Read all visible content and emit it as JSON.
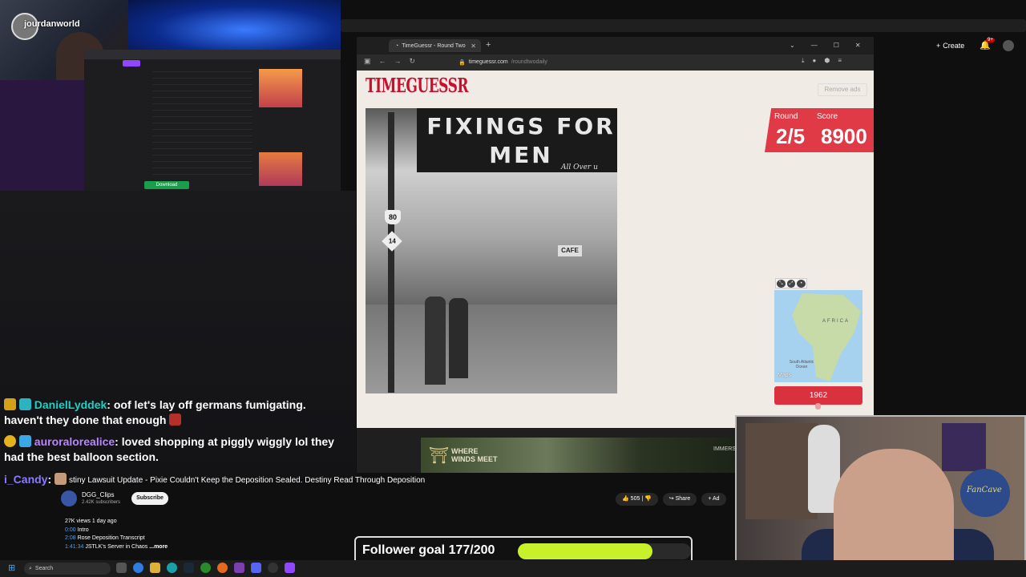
{
  "streamer": {
    "name": "jourdanworld"
  },
  "mini_screen": {
    "download_label": "Download"
  },
  "browser": {
    "tab_title": "TimeGuessr - Round Two",
    "url_domain": "timeguessr.com",
    "url_path": "/roundtwodaily"
  },
  "youtube_header": {
    "create_label": "Create",
    "notif_badge": "9+"
  },
  "game": {
    "logo": "TIMEGUESSR",
    "remove_ads": "Remove ads",
    "round_label": "Round",
    "score_label": "Score",
    "round_value": "2/5",
    "score_value": "8900",
    "photo_sign": "FIXINGS FOR MEN",
    "photo_sign_sub": "All Over u",
    "photo_route_80": "80",
    "photo_route_14": "14",
    "photo_cafe": "CAFE",
    "map_label": "AFRICA",
    "map_ocean": "South Atlantic Ocean",
    "maps_logo": "Maps",
    "year": "1962"
  },
  "ad": {
    "title_line1": "WHERE",
    "title_line2": "WINDS MEET",
    "right_text": "IMMERS"
  },
  "chat": [
    {
      "user": "DanielLyddek",
      "message": "oof let's lay off germans fumigating. haven't they done that enough"
    },
    {
      "user": "auroralorealice",
      "message": "loved shopping at piggly wiggly lol they had the best balloon section."
    },
    {
      "user": "i_Candy",
      "message": ""
    }
  ],
  "video": {
    "title": "stiny Lawsuit Update - Pixie Couldn't Keep the Deposition Sealed. Destiny Read Through Deposition",
    "channel": "DGG_Clips",
    "subscribers": "2.42K subscribers",
    "subscribe_label": "Subscribe",
    "likes": "505",
    "share_label": "Share",
    "add_label": "Ad",
    "meta": "27K views  1 day ago",
    "chapters": [
      {
        "time": "0:00",
        "label": "Intro"
      },
      {
        "time": "2:08",
        "label": "Rose Deposition Transcript"
      },
      {
        "time": "1:41:34",
        "label": "JSTLK's Server in Chaos"
      }
    ],
    "more_label": "...more"
  },
  "follower_goal": {
    "text": "Follower goal 177/200",
    "current": 177,
    "target": 200
  },
  "webcam2": {
    "poster_text": "FanCave"
  },
  "taskbar": {
    "search_placeholder": "Search"
  },
  "colors": {
    "accent_red": "#e03a46",
    "goal_green": "#c7f12a",
    "chat_user1": "#1fd1c4",
    "chat_user2": "#b985ff"
  }
}
